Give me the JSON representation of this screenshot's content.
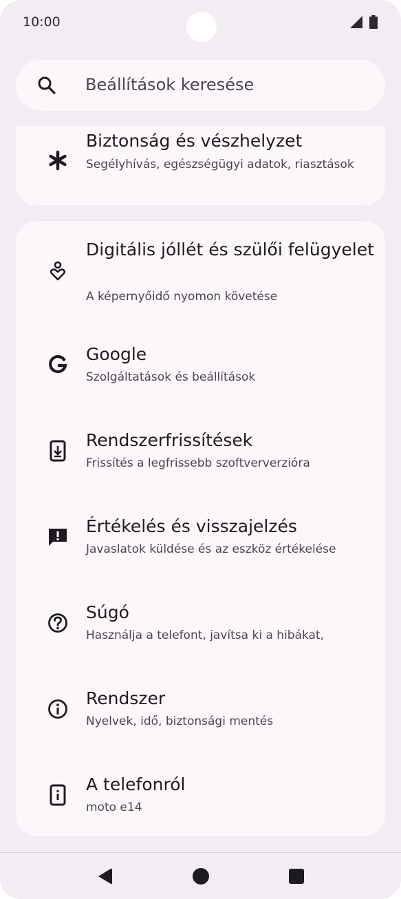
{
  "status_bar": {
    "time": "10:00"
  },
  "search": {
    "placeholder": "Beállítások keresése"
  },
  "partial_item": {
    "title": "Biztonság és vészhelyzet",
    "subtitle": "Segélyhívás, egészségügyi adatok, riasztások",
    "icon": "asterisk-icon"
  },
  "items": [
    {
      "title": "Digitális jóllét és szülői felügyelet",
      "subtitle": "A képernyőidő nyomon követése",
      "icon": "digital-wellbeing-icon"
    },
    {
      "title": "Google",
      "subtitle": "Szolgáltatások és beállítások",
      "icon": "google-icon"
    },
    {
      "title": "Rendszerfrissítések",
      "subtitle": "Frissítés a legfrissebb szoftververzióra",
      "icon": "system-update-icon"
    },
    {
      "title": "Értékelés és visszajelzés",
      "subtitle": "Javaslatok küldése és az eszköz értékelése",
      "icon": "feedback-icon"
    },
    {
      "title": "Súgó",
      "subtitle": "Használja a telefont, javítsa ki a hibákat,",
      "icon": "help-icon"
    },
    {
      "title": "Rendszer",
      "subtitle": "Nyelvek, idő, biztonsági mentés",
      "icon": "info-icon"
    },
    {
      "title": "A telefonról",
      "subtitle": "moto e14",
      "icon": "phone-info-icon"
    }
  ],
  "nav_bar": {
    "back": "back-icon",
    "home": "home-icon",
    "recents": "recents-icon"
  },
  "colors": {
    "background": "#f3edf3",
    "card": "#fdf7fb",
    "text_primary": "#1d1b20",
    "text_secondary": "#49454f"
  }
}
